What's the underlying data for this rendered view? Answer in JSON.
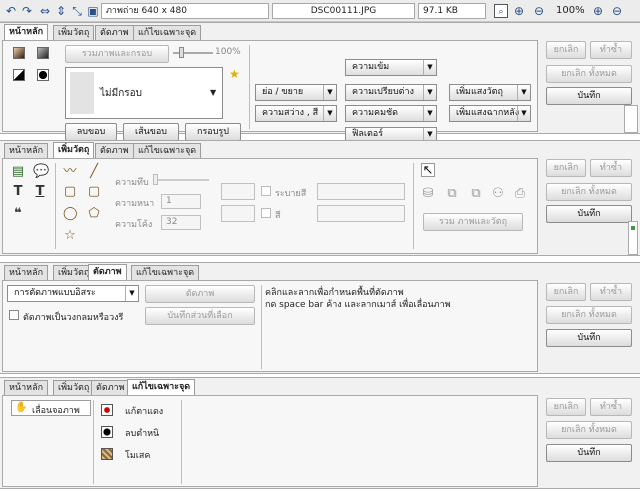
{
  "toolbar": {
    "image_info": "ภาพถ่าย 640 x 480",
    "filename": "DSC00111.JPG",
    "filesize": "97.1 KB",
    "zoom": "100%"
  },
  "actions": {
    "undo": "ยกเลิก",
    "redo": "ทำซ้ำ",
    "undo_all": "ยกเลิก ทั้งหมด",
    "save": "บันทึก"
  },
  "panel1": {
    "tabs": [
      "หน้าหลัก",
      "เพิ่มวัตถุ",
      "ตัดภาพ",
      "แก้ไขเฉพาะจุด"
    ],
    "combine_btn": "รวมภาพและกรอบ",
    "opacity": "100%",
    "frame_select": "ไม่มีกรอบ",
    "erase": "ลบขอบ",
    "border": "เส้นขอบ",
    "frame_pic": "กรอบรูป",
    "resize": "ย่อ / ขยาย",
    "brightness": "ความสว่าง , สี",
    "sharp": "ความเข้ม",
    "contrast": "ความเปรียบต่าง",
    "clarity": "ความคมชัด",
    "filter": "ฟิลเตอร์",
    "add_object_light": "เพิ่มแสงวัตถุ",
    "add_bg_light": "เพิ่มแสงฉากหลัง"
  },
  "panel2": {
    "tabs": [
      "หน้าหลัก",
      "เพิ่มวัตถุ",
      "ตัดภาพ",
      "แก้ไขเฉพาะจุด"
    ],
    "opacity_label": "ความทึบ",
    "thickness_label": "ความหนา",
    "thickness_value": "1",
    "curve_label": "ความโค้ง",
    "curve_value": "32",
    "fill_label": "ระบายสี",
    "color_label": "สี",
    "merge_btn": "รวม ภาพและวัตถุ"
  },
  "panel3": {
    "tabs": [
      "หน้าหลัก",
      "เพิ่มวัตถุ",
      "ตัดภาพ",
      "แก้ไขเฉพาะจุด"
    ],
    "mode_select": "การตัดภาพแบบอิสระ",
    "crop_btn": "ตัดภาพ",
    "save_sel_btn": "บันทึกส่วนที่เลือก",
    "round_check": "ตัดภาพเป็นวงกลมหรือวงรี",
    "hint1": "คลิกและลากเพื่อกำหนดพื้นที่ตัดภาพ",
    "hint2": "กด space bar ค้าง และลากเมาส์ เพื่อเลื่อนภาพ"
  },
  "panel4": {
    "tabs": [
      "หน้าหลัก",
      "เพิ่มวัตถุ",
      "ตัดภาพ",
      "แก้ไขเฉพาะจุด"
    ],
    "move_label": "เลื่อนจอภาพ",
    "redeye": "แก้ตาแดง",
    "blemish": "ลบตำหนิ",
    "mosaic": "โมเสค"
  }
}
